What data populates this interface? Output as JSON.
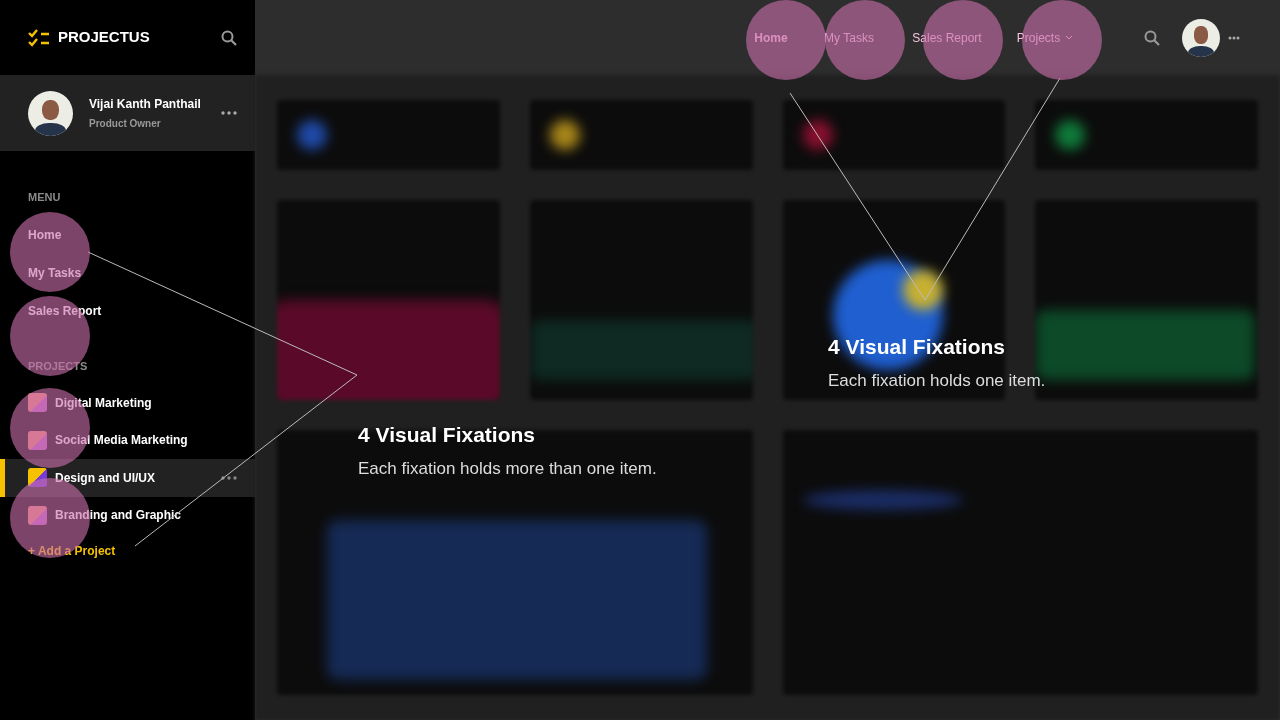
{
  "brand": {
    "name": "PROJECTUS"
  },
  "user": {
    "name": "Vijai Kanth Panthail",
    "role": "Product Owner"
  },
  "sidebar": {
    "menu_heading": "MENU",
    "menu_items": [
      {
        "label": "Home",
        "selected": false
      },
      {
        "label": "My Tasks",
        "selected": false
      },
      {
        "label": "Sales Report",
        "selected": false
      }
    ],
    "projects_heading": "PROJECTS",
    "projects": [
      {
        "label": "Digital Marketing",
        "selected": false
      },
      {
        "label": "Social Media Marketing",
        "selected": false
      },
      {
        "label": "Design and UI/UX",
        "selected": true
      },
      {
        "label": "Branding and Graphic",
        "selected": false
      }
    ],
    "add_project": "+ Add a Project"
  },
  "top_nav": [
    {
      "label": "Home",
      "selected": true,
      "dropdown": false
    },
    {
      "label": "My Tasks",
      "selected": false,
      "dropdown": false
    },
    {
      "label": "Sales Report",
      "selected": false,
      "dropdown": false
    },
    {
      "label": "Projects",
      "selected": false,
      "dropdown": true
    }
  ],
  "annotations": [
    {
      "title": "4 Visual Fixations",
      "text": "Each fixation holds more than one item."
    },
    {
      "title": "4 Visual Fixations",
      "text": "Each fixation holds one item."
    }
  ]
}
